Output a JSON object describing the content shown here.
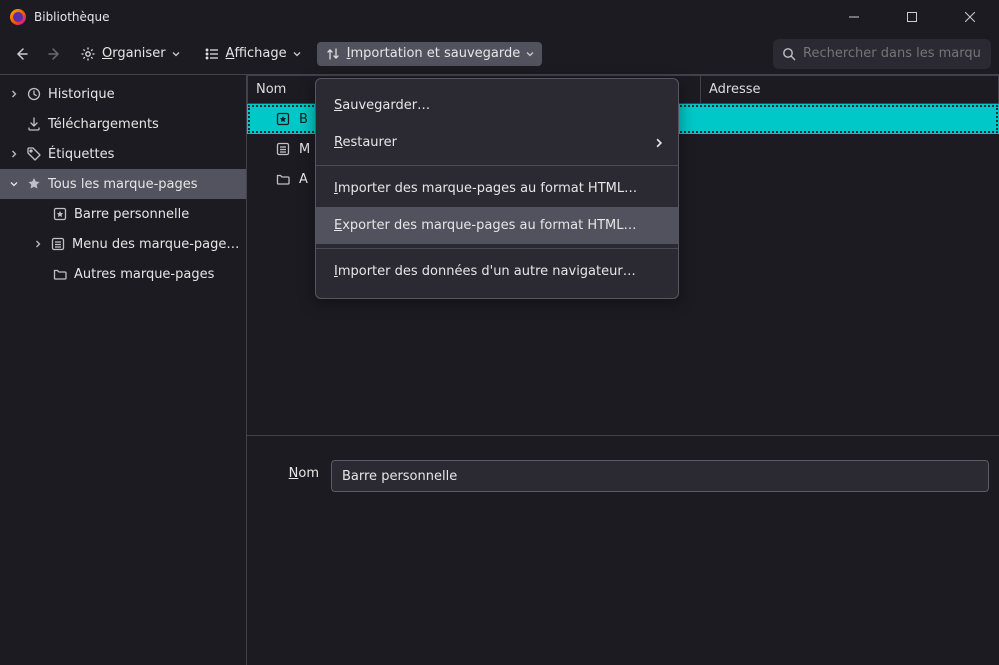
{
  "window": {
    "title": "Bibliothèque"
  },
  "toolbar": {
    "organize": {
      "prefix": "O",
      "rest": "rganiser"
    },
    "display": {
      "prefix": "A",
      "rest": "ffichage"
    },
    "import_export": {
      "prefix": "I",
      "rest": "mportation et sauvegarde"
    },
    "search_placeholder": "Rechercher dans les marque-pages"
  },
  "sidebar": {
    "history": "Historique",
    "downloads": "Téléchargements",
    "tags": "Étiquettes",
    "all_bookmarks": "Tous les marque-pages",
    "toolbar_bookmarks": "Barre personnelle",
    "menu_bookmarks": "Menu des marque-page…",
    "other_bookmarks": "Autres marque-pages"
  },
  "columns": {
    "name": "Nom",
    "address": "Adresse"
  },
  "list": {
    "row0_abbrev": "B",
    "row1_abbrev": "M",
    "row2_abbrev": "A"
  },
  "dropdown": {
    "backup": {
      "prefix": "S",
      "rest": "auvegarder…"
    },
    "restore": {
      "prefix": "R",
      "rest": "estaurer"
    },
    "import_html": {
      "prefix": "I",
      "rest": "mporter des marque-pages au format HTML…"
    },
    "export_html": {
      "prefix": "E",
      "rest": "xporter des marque-pages au format HTML…"
    },
    "import_other": {
      "prefix": "I",
      "rest": "mporter des données d'un autre navigateur…"
    }
  },
  "details": {
    "label_prefix": "N",
    "label_rest": "om",
    "value": "Barre personnelle"
  }
}
